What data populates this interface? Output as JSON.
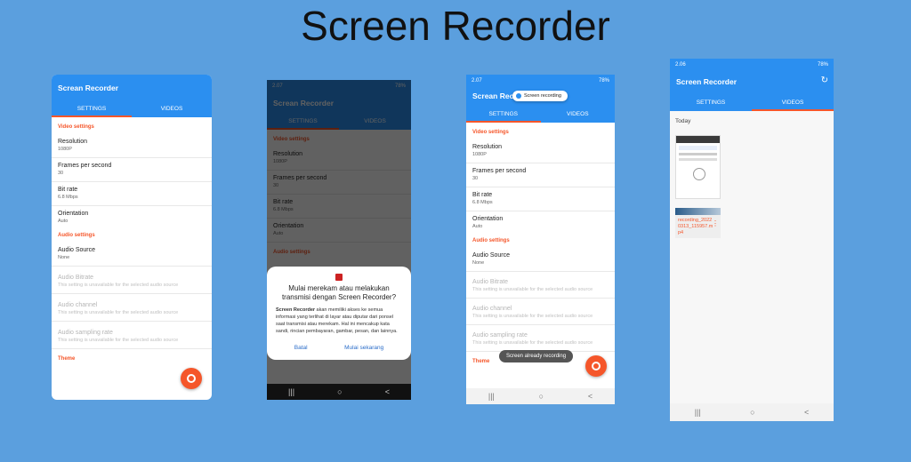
{
  "page_title": "Screen Recorder",
  "app": {
    "title": "Screan Recorder",
    "title_alt": "Screen Recorder",
    "tabs": [
      "SETTINGS",
      "VIDEOS"
    ]
  },
  "status": {
    "time_a": "2.07",
    "time_b": "2.06",
    "battery": "78%"
  },
  "settings": {
    "video_header": "Video settings",
    "audio_header": "Audio settings",
    "theme_header": "Theme",
    "video": [
      {
        "title": "Resolution",
        "value": "1080P"
      },
      {
        "title": "Frames per second",
        "value": "30"
      },
      {
        "title": "Bit rate",
        "value": "6.8 Mbps"
      },
      {
        "title": "Orientation",
        "value": "Auto"
      }
    ],
    "audio_source": {
      "title": "Audio Source",
      "value": "None"
    },
    "audio_disabled": [
      {
        "title": "Audio Bitrate",
        "value": "This setting is unavailable for the selected audio source"
      },
      {
        "title": "Audio channel",
        "value": "This setting is unavailable for the selected audio source"
      },
      {
        "title": "Audio sampling rate",
        "value": "This setting is unavailable for the selected audio source"
      }
    ]
  },
  "dialog": {
    "title": "Mulai merekam atau melakukan transmisi dengan Screen Recorder?",
    "app_name": "Screen Recorder",
    "body": " akan memiliki akses ke semua informasi yang terlihat di layar atau diputar dari ponsel saat transmisi atau merekam. Hal ini mencakup kata sandi, rincian pembayaran, gambar, pesan, dan lainnya.",
    "cancel": "Batal",
    "confirm": "Mulai sekarang"
  },
  "notifications": {
    "recording_pill": "Screen recording",
    "already_toast": "Screen already recording"
  },
  "videos": {
    "group": "Today",
    "file_name": "recording_20220313_115957.mp4"
  },
  "nav": {
    "recents": "|||",
    "home": "○",
    "back": "<"
  },
  "colors": {
    "accent": "#2b8ff0",
    "orange": "#f5562a",
    "background": "#5b9fde"
  }
}
